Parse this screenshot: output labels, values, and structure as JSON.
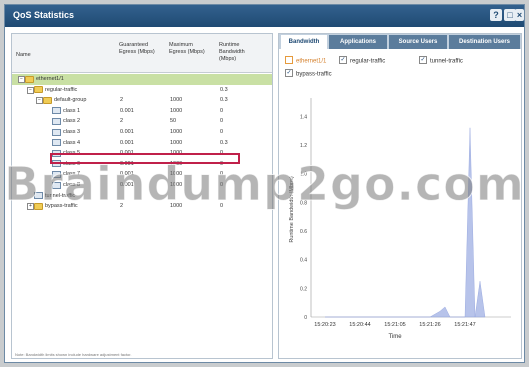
{
  "window": {
    "title": "QoS Statistics"
  },
  "table": {
    "columns": [
      "Name",
      "Guaranteed Egress (Mbps)",
      "Maximum Egress (Mbps)",
      "Runtime Bandwidth (Mbps)"
    ],
    "rows": [
      {
        "name": "ethernet1/1",
        "guaranteed": "",
        "maximum": "",
        "runtime": ""
      },
      {
        "name": "regular-traffic",
        "guaranteed": "",
        "maximum": "",
        "runtime": "0.3"
      },
      {
        "name": "default-group",
        "guaranteed": "2",
        "maximum": "1000",
        "runtime": "0.3"
      },
      {
        "name": "class 1",
        "guaranteed": "0.001",
        "maximum": "1000",
        "runtime": "0"
      },
      {
        "name": "class 2",
        "guaranteed": "2",
        "maximum": "50",
        "runtime": "0"
      },
      {
        "name": "class 3",
        "guaranteed": "0.001",
        "maximum": "1000",
        "runtime": "0"
      },
      {
        "name": "class 4",
        "guaranteed": "0.001",
        "maximum": "1000",
        "runtime": "0.3"
      },
      {
        "name": "class 5",
        "guaranteed": "0.001",
        "maximum": "1000",
        "runtime": "0"
      },
      {
        "name": "class 6",
        "guaranteed": "0.001",
        "maximum": "1000",
        "runtime": "0"
      },
      {
        "name": "class 7",
        "guaranteed": "0.001",
        "maximum": "1000",
        "runtime": "0"
      },
      {
        "name": "class 8",
        "guaranteed": "0.001",
        "maximum": "1000",
        "runtime": "0"
      },
      {
        "name": "tunnel-traffic",
        "guaranteed": "",
        "maximum": "",
        "runtime": ""
      },
      {
        "name": "bypass-traffic",
        "guaranteed": "2",
        "maximum": "1000",
        "runtime": "0"
      }
    ],
    "footnote": "Note: Bandwidth limits shown include hardware adjustment factor."
  },
  "tabs": [
    "Bandwidth",
    "Applications",
    "Source Users",
    "Destination Users"
  ],
  "legend": {
    "items": [
      {
        "label": "ethernet1/1",
        "checked": false
      },
      {
        "label": "regular-traffic",
        "checked": true
      },
      {
        "label": "tunnel-traffic",
        "checked": true
      },
      {
        "label": "bypass-traffic",
        "checked": true
      }
    ]
  },
  "chart_data": {
    "type": "area",
    "ylabel": "Runtime Bandwidth (Mbps)",
    "xlabel": "Time",
    "x_ticks": [
      "15:20:23",
      "15:20:44",
      "15:21:05",
      "15:21:26",
      "15:21:47"
    ],
    "y_ticks": [
      "0",
      "0.2",
      "0.4",
      "0.6",
      "0.8",
      "1.0",
      "1.2",
      "1.4"
    ],
    "ylim": [
      0,
      1.5
    ],
    "series": [
      {
        "name": "regular-traffic",
        "color": "#aab8e6",
        "x": [
          "15:20:23",
          "15:20:44",
          "15:21:05",
          "15:21:26",
          "15:21:32",
          "15:21:35",
          "15:21:38",
          "15:21:47",
          "15:21:50",
          "15:21:53",
          "15:21:56",
          "15:21:59"
        ],
        "values": [
          0,
          0,
          0,
          0,
          0.04,
          0.07,
          0,
          0,
          1.32,
          0,
          0.25,
          0
        ]
      }
    ],
    "grid": false
  },
  "watermark": "Braindump2go.com",
  "colors": {
    "titlebar": "#1f4a73",
    "selection": "#c9e0a4",
    "highlight": "#c0204a"
  }
}
